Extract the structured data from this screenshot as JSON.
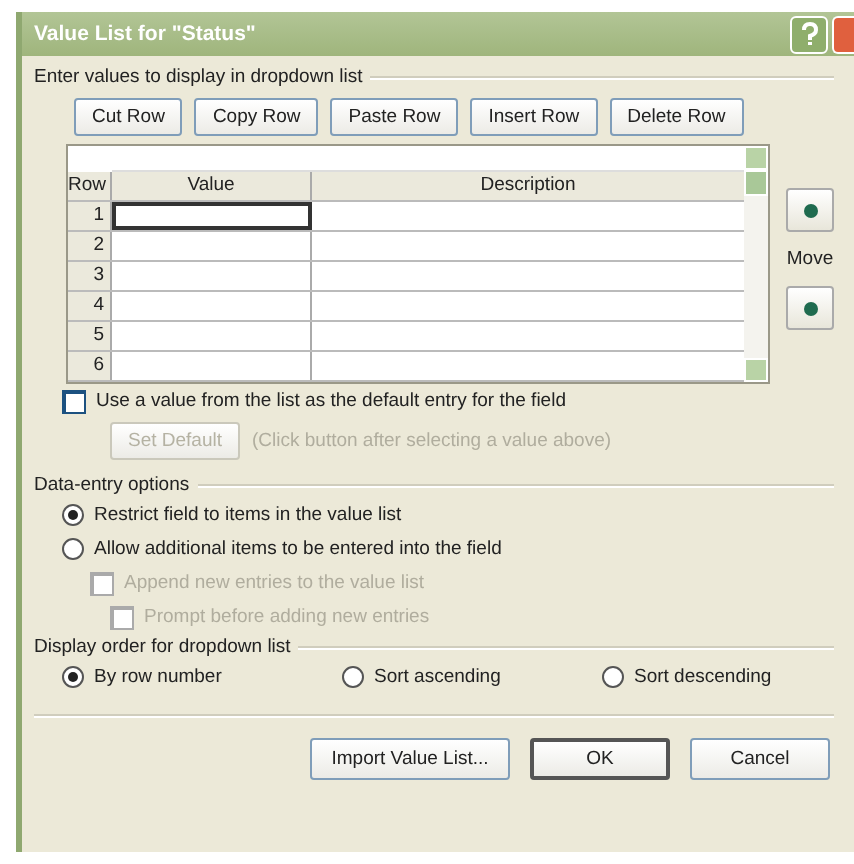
{
  "window": {
    "title": "Value List for \"Status\""
  },
  "list_section": {
    "label": "Enter values to display in dropdown list"
  },
  "row_buttons": [
    "Cut Row",
    "Copy Row",
    "Paste Row",
    "Insert Row",
    "Delete Row"
  ],
  "grid": {
    "columns": [
      "Row",
      "Value",
      "Description"
    ],
    "rows": [
      {
        "number": "1",
        "selected": true
      },
      {
        "number": "2",
        "selected": false
      },
      {
        "number": "3",
        "selected": false
      },
      {
        "number": "4",
        "selected": false
      },
      {
        "number": "5",
        "selected": false
      },
      {
        "number": "6",
        "selected": false
      }
    ]
  },
  "move": {
    "label": "Move"
  },
  "default_option": {
    "label": "Use a value from the list as the default entry for the field",
    "checked": false
  },
  "set_default": {
    "label": "Set Default",
    "disabled": true,
    "hint": "(Click button after selecting a value above)"
  },
  "data_entry": {
    "label": "Data-entry options",
    "options": [
      {
        "kind": "radio",
        "label": "Restrict field to items in the value list",
        "selected": true
      },
      {
        "kind": "radio",
        "label": "Allow additional items to be entered into the field",
        "selected": false
      },
      {
        "kind": "checkbox",
        "label": "Append new entries to the value list",
        "checked": false,
        "disabled": true,
        "children": [
          {
            "kind": "checkbox",
            "label": "Prompt before adding new entries",
            "checked": false,
            "disabled": true
          }
        ]
      }
    ]
  },
  "display_order": {
    "label": "Display order for dropdown list",
    "options": [
      {
        "label": "By row number",
        "selected": true
      },
      {
        "label": "Sort ascending",
        "selected": false
      },
      {
        "label": "Sort descending",
        "selected": false
      }
    ]
  },
  "footer_buttons": [
    {
      "label": "Import Value List...",
      "default": false
    },
    {
      "label": "OK",
      "default": true
    },
    {
      "label": "Cancel",
      "default": false
    }
  ]
}
